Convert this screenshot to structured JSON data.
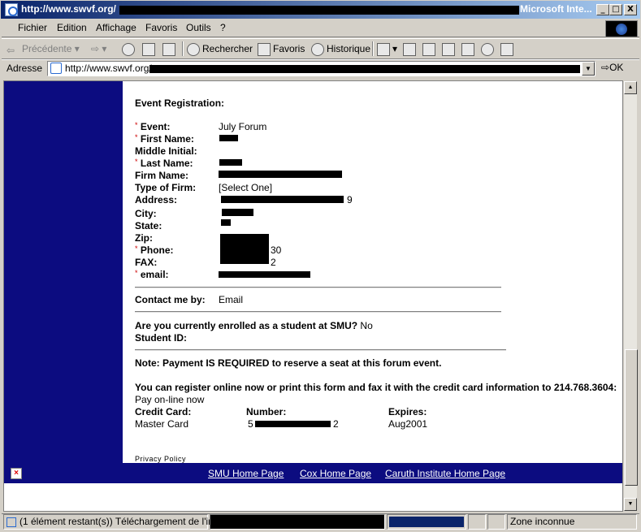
{
  "window": {
    "title_url": "http://www.swvf.org/",
    "app_name": "Microsoft Inte...",
    "btn_min": "_",
    "btn_max": "□",
    "btn_close": "X"
  },
  "menu": {
    "items": [
      "Fichier",
      "Edition",
      "Affichage",
      "Favoris",
      "Outils",
      "?"
    ]
  },
  "toolbar": {
    "back": "Précédente",
    "search": "Rechercher",
    "favorites": "Favoris",
    "history": "Historique"
  },
  "address": {
    "label": "Adresse",
    "url": "http://www.swvf.org/",
    "go": "OK"
  },
  "form": {
    "heading": "Event Registration:",
    "required_mark": "*",
    "fields": {
      "event_label": "Event:",
      "event_value": "July Forum",
      "first_name_label": "First Name:",
      "middle_initial_label": "Middle Initial:",
      "last_name_label": "Last Name:",
      "firm_name_label": "Firm Name:",
      "type_of_firm_label": "Type of Firm:",
      "type_of_firm_value": "[Select One]",
      "address_label": "Address:",
      "address_suffix": "9",
      "city_label": "City:",
      "state_label": "State:",
      "zip_label": "Zip:",
      "phone_label": "Phone:",
      "phone_suffix": "30",
      "fax_label": "FAX:",
      "fax_suffix": "2",
      "email_label": "email:"
    },
    "contact_label": "Contact me by:",
    "contact_value": "Email",
    "student_question": "Are you currently enrolled as a student at SMU?",
    "student_answer": "No",
    "student_id_label": "Student ID:",
    "payment_note": "Note: Payment IS REQUIRED to reserve a seat at this forum event.",
    "register_text": "You can register online now or print this form and fax it with the credit card information to 214.768.3604:",
    "pay_online": "Pay on-line now",
    "card": {
      "card_label": "Credit Card:",
      "number_label": "Number:",
      "expires_label": "Expires:",
      "card_value": "Master Card",
      "number_prefix": "5",
      "number_suffix": "2",
      "expires_value": "Aug2001"
    },
    "privacy": "Privacy Policy"
  },
  "footer": {
    "links": [
      "SMU Home Page",
      "Cox Home Page",
      "Caruth Institute Home Page"
    ]
  },
  "status": {
    "text": "(1 élément restant(s)) Téléchargement de l'image",
    "zone": "Zone inconnue"
  }
}
